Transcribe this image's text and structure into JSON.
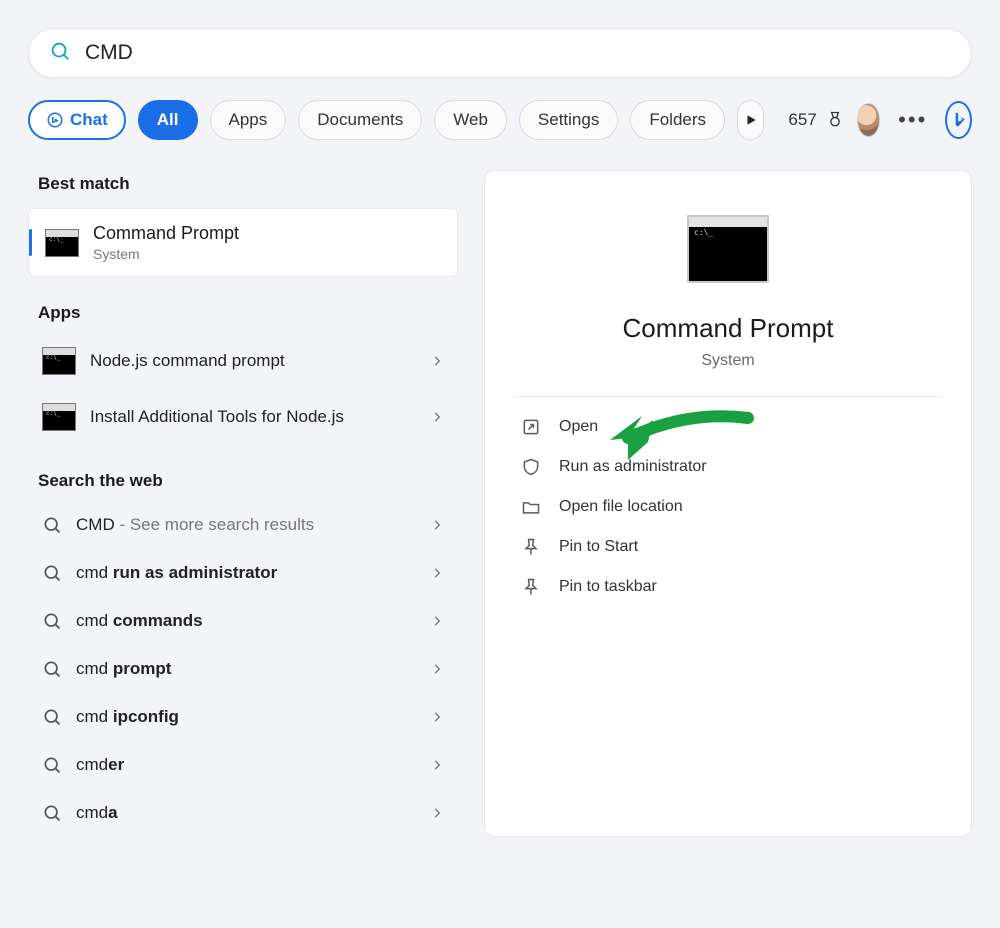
{
  "search": {
    "value": "CMD"
  },
  "filters": {
    "chat": "Chat",
    "all": "All",
    "apps": "Apps",
    "documents": "Documents",
    "web": "Web",
    "settings": "Settings",
    "folders": "Folders"
  },
  "rewards_count": "657",
  "sections": {
    "best_match": "Best match",
    "apps": "Apps",
    "search_web": "Search the web"
  },
  "best": {
    "title": "Command Prompt",
    "subtitle": "System"
  },
  "apps_list": [
    {
      "label": "Node.js command prompt"
    },
    {
      "label": "Install Additional Tools for Node.js"
    }
  ],
  "web_list": [
    {
      "prefix": "CMD",
      "bold": "",
      "suffix": " - See more search results"
    },
    {
      "prefix": "cmd ",
      "bold": "run as administrator",
      "suffix": ""
    },
    {
      "prefix": "cmd ",
      "bold": "commands",
      "suffix": ""
    },
    {
      "prefix": "cmd ",
      "bold": "prompt",
      "suffix": ""
    },
    {
      "prefix": "cmd ",
      "bold": "ipconfig",
      "suffix": ""
    },
    {
      "prefix": "cmd",
      "bold": "er",
      "suffix": ""
    },
    {
      "prefix": "cmd",
      "bold": "a",
      "suffix": ""
    }
  ],
  "detail": {
    "title": "Command Prompt",
    "subtitle": "System",
    "actions": {
      "open": "Open",
      "run_admin": "Run as administrator",
      "open_loc": "Open file location",
      "pin_start": "Pin to Start",
      "pin_task": "Pin to taskbar"
    }
  }
}
